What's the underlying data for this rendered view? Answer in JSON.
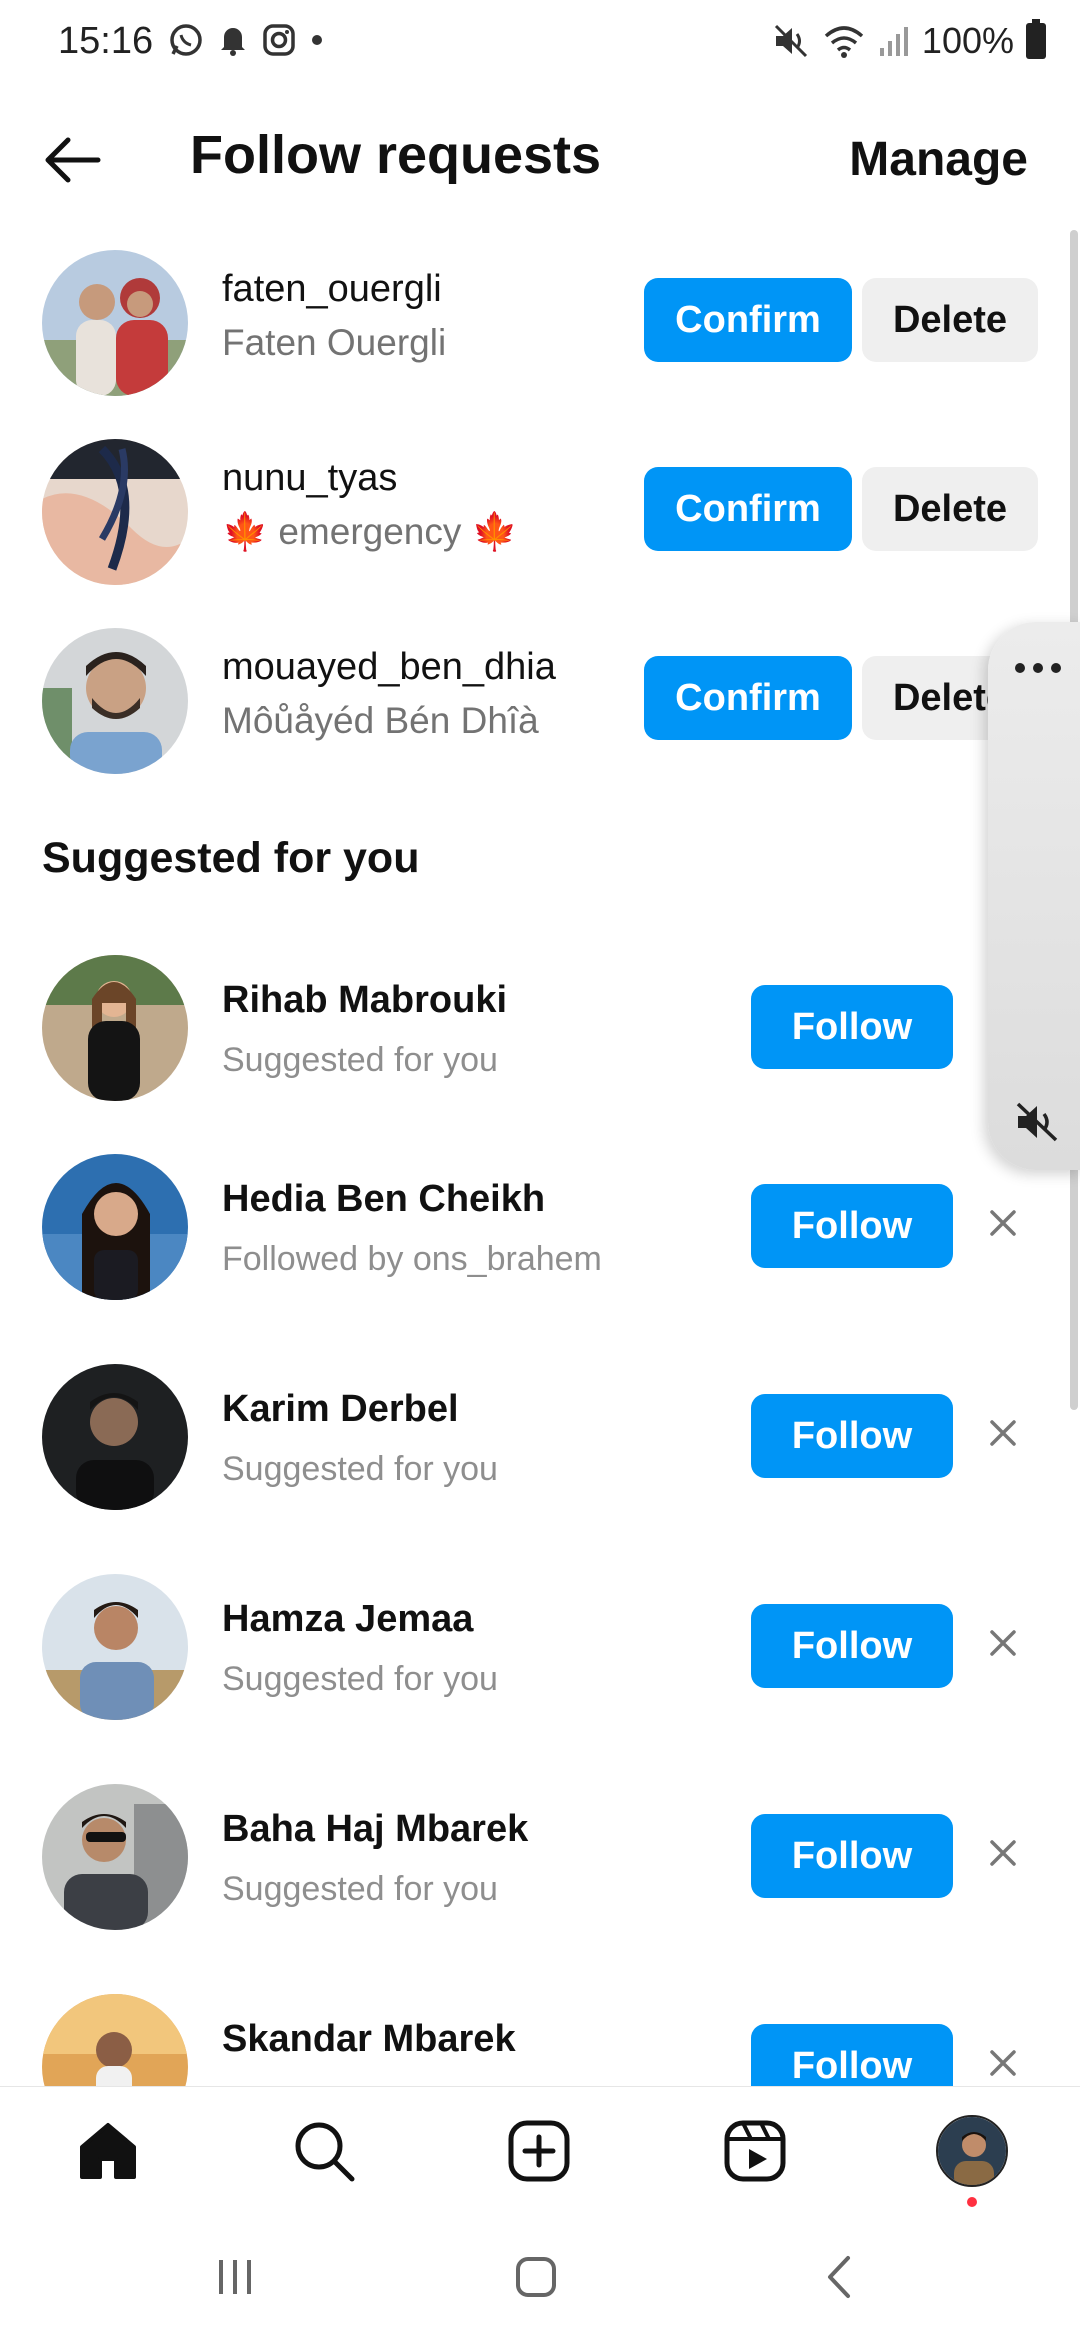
{
  "status_bar": {
    "time": "15:16",
    "battery": "100%"
  },
  "header": {
    "title": "Follow requests",
    "manage": "Manage"
  },
  "requests": [
    {
      "username": "faten_ouergli",
      "full_name": "Faten Ouergli",
      "confirm": "Confirm",
      "delete": "Delete"
    },
    {
      "username": "nunu_tyas",
      "full_name": "🍁 emergency 🍁",
      "confirm": "Confirm",
      "delete": "Delete"
    },
    {
      "username": "mouayed_ben_dhia",
      "full_name": "Môůåyéd Bén Dhîà",
      "confirm": "Confirm",
      "delete": "Delete"
    }
  ],
  "suggested_title": "Suggested for you",
  "suggestions": [
    {
      "name": "Rihab Mabrouki",
      "subtitle": "Suggested for you",
      "follow": "Follow"
    },
    {
      "name": "Hedia Ben Cheikh",
      "subtitle": "Followed by ons_brahem",
      "follow": "Follow"
    },
    {
      "name": "Karim Derbel",
      "subtitle": "Suggested for you",
      "follow": "Follow"
    },
    {
      "name": "Hamza Jemaa",
      "subtitle": "Suggested for you",
      "follow": "Follow"
    },
    {
      "name": "Baha Haj Mbarek",
      "subtitle": "Suggested for you",
      "follow": "Follow"
    },
    {
      "name": "Skandar Mbarek",
      "subtitle": "",
      "follow": "Follow"
    }
  ],
  "colors": {
    "accent": "#0095f6",
    "secondary_button": "#efefef",
    "muted_text": "#737373",
    "notification_dot": "#ff3040"
  },
  "icons": {
    "status_left": [
      "whatsapp-icon",
      "bell-icon",
      "instagram-icon",
      "dot-icon"
    ],
    "status_right": [
      "mute-icon",
      "wifi-icon",
      "signal-icon",
      "battery-icon"
    ],
    "bottom_nav": [
      "home-icon",
      "search-icon",
      "create-icon",
      "reels-icon",
      "profile-avatar"
    ],
    "system_nav": [
      "recents-icon",
      "home-button-icon",
      "back-icon"
    ]
  }
}
